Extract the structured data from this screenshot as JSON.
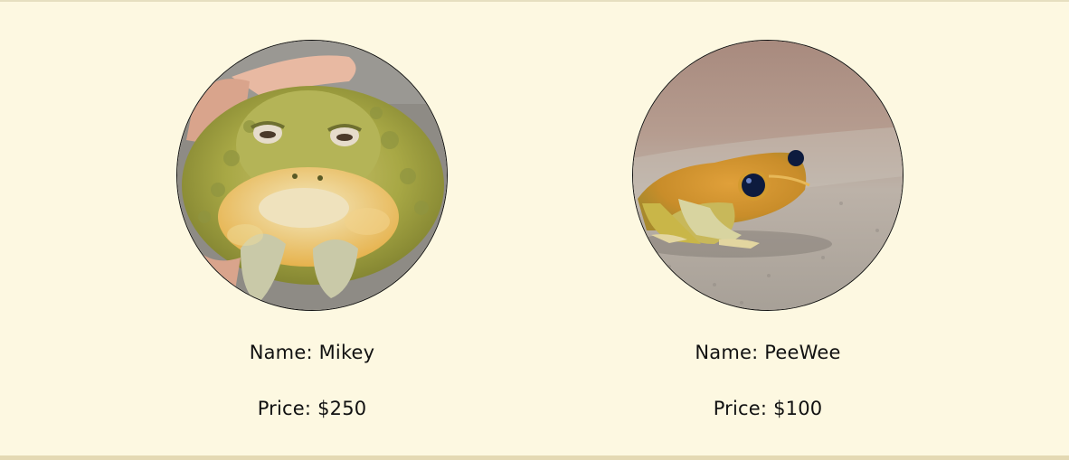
{
  "products": [
    {
      "name_text": "Name: Mikey",
      "price_text": "Price: $250",
      "image_icon": "toad-photo"
    },
    {
      "name_text": "Name: PeeWee",
      "price_text": "Price: $100",
      "image_icon": "frog-photo"
    }
  ],
  "colors": {
    "background": "#fdf8e1",
    "bottom_border": "#e4d9b3",
    "text": "#111111"
  }
}
